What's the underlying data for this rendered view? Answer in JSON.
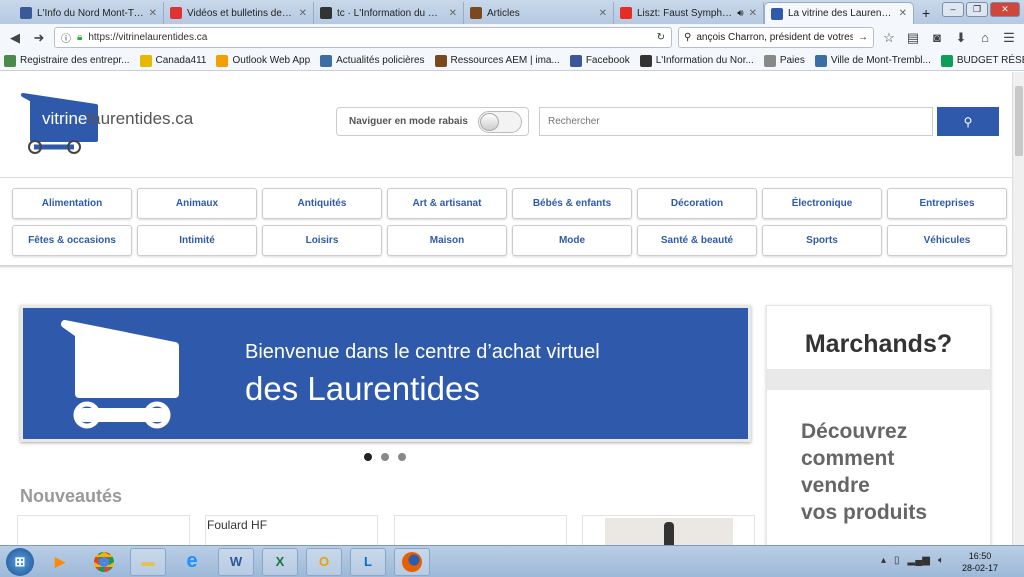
{
  "browser": {
    "tabs": [
      {
        "title": "L'Info du Nord Mont-Tr...",
        "color": "#3b5998"
      },
      {
        "title": "Vidéos et bulletins de no...",
        "color": "#d33"
      },
      {
        "title": "tc · L'Information du Nord ...",
        "color": "#333"
      },
      {
        "title": "Articles",
        "color": "#7a4a1e"
      },
      {
        "title": "Liszt: Faust Sympho...",
        "color": "#e52d27"
      },
      {
        "title": "La vitrine des Laurentide...",
        "color": "#2f5aab"
      }
    ],
    "new_tab": "+",
    "url": "https://vitrinelaurentides.ca",
    "search_value": "ançois Charron, président de votresite.ca",
    "bookmarks": [
      {
        "label": "Registraire des entrepr...",
        "color": "#4a8a4a"
      },
      {
        "label": "Canada411",
        "color": "#e6b800"
      },
      {
        "label": "Outlook Web App",
        "color": "#f0a000"
      },
      {
        "label": "Actualités policières",
        "color": "#3a6ea5"
      },
      {
        "label": "Ressources AEM | ima...",
        "color": "#7a4a1e"
      },
      {
        "label": "Facebook",
        "color": "#3b5998"
      },
      {
        "label": "L'Information du Nor...",
        "color": "#333"
      },
      {
        "label": "Paies",
        "color": "#888"
      },
      {
        "label": "Ville de Mont-Trembl...",
        "color": "#3a6ea5"
      },
      {
        "label": "BUDGET RÉSEAU TC ...",
        "color": "#0f9d58"
      }
    ]
  },
  "site": {
    "logo": {
      "part1": "vitrine",
      "part2": "laurentides.ca"
    },
    "rabais_label": "Naviguer en mode rabais",
    "rabais_on": false,
    "search_placeholder": "Rechercher",
    "categories": [
      "Alimentation",
      "Animaux",
      "Antiquités",
      "Art & artisanat",
      "Bébés & enfants",
      "Décoration",
      "Électronique",
      "Entreprises",
      "Fêtes & occasions",
      "Intimité",
      "Loisirs",
      "Maison",
      "Mode",
      "Santé & beauté",
      "Sports",
      "Véhicules"
    ],
    "banner": {
      "line1": "Bienvenue dans le centre d’achat virtuel",
      "line2": "des Laurentides",
      "slides": 3,
      "active_slide": 1
    },
    "side": {
      "title": "Marchands?",
      "text": "Découvrez\ncomment\nvendre\nvos produits"
    },
    "nouveautes_title": "Nouveautés",
    "products": [
      "",
      "Foulard HF",
      "",
      ""
    ],
    "accent": "#2f5aab"
  },
  "taskbar": {
    "time": "16:50",
    "date": "28-02-17"
  }
}
